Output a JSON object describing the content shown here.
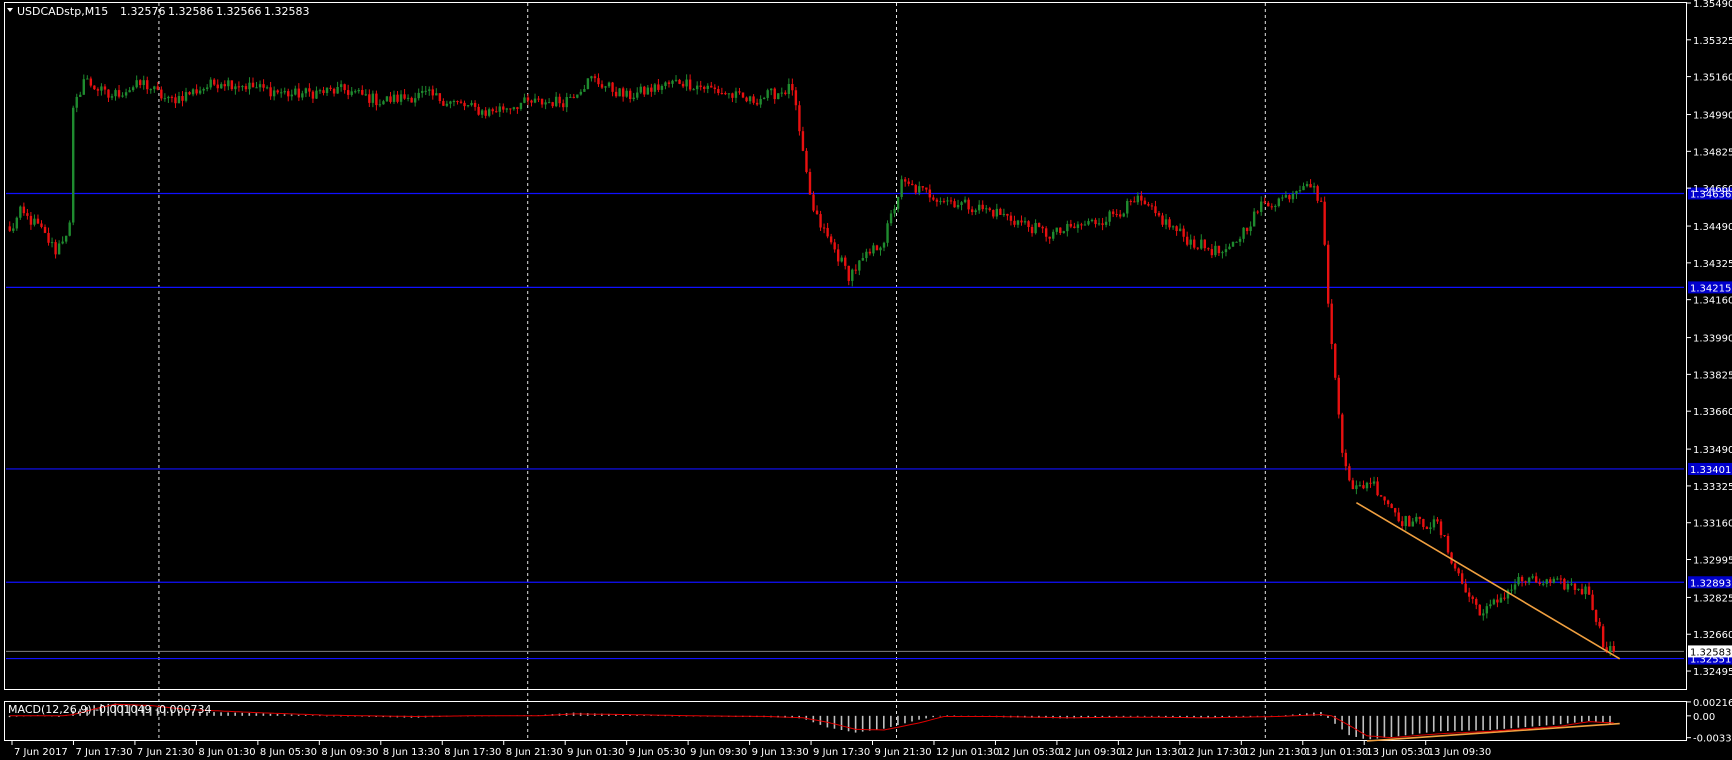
{
  "symbol": "USDCADstp,M15",
  "ohlc": {
    "open": "1.32576",
    "high": "1.32586",
    "low": "1.32566",
    "close": "1.32583"
  },
  "header_menu_icon": "triangle-down-icon",
  "colors": {
    "background": "#000000",
    "bull_candle": "#1f8b2f",
    "bear_candle": "#e81010",
    "level_line": "#1010ff",
    "level_tag": "#0000cc",
    "trendline": "#f0a040",
    "macd_hist": "#c0c0c0",
    "macd_signal": "#e00000",
    "current_price_line": "#808080"
  },
  "chart_data": {
    "type": "candlestick",
    "price_axis": {
      "ylim": [
        1.3241,
        1.3549
      ],
      "ticks": [
        "1.35490",
        "1.35325",
        "1.35160",
        "1.34990",
        "1.34825",
        "1.34660",
        "1.34490",
        "1.34325",
        "1.34160",
        "1.33990",
        "1.33825",
        "1.33660",
        "1.33490",
        "1.33325",
        "1.33160",
        "1.32995",
        "1.32825",
        "1.32660",
        "1.32495"
      ],
      "current_price": "1.32583"
    },
    "time_axis": {
      "labels": [
        "7 Jun 2017",
        "7 Jun 17:30",
        "7 Jun 21:30",
        "8 Jun 01:30",
        "8 Jun 05:30",
        "8 Jun 09:30",
        "8 Jun 13:30",
        "8 Jun 17:30",
        "8 Jun 21:30",
        "9 Jun 01:30",
        "9 Jun 05:30",
        "9 Jun 09:30",
        "9 Jun 13:30",
        "9 Jun 17:30",
        "9 Jun 21:30",
        "12 Jun 01:30",
        "12 Jun 05:30",
        "12 Jun 09:30",
        "12 Jun 13:30",
        "12 Jun 17:30",
        "12 Jun 21:30",
        "13 Jun 01:30",
        "13 Jun 05:30",
        "13 Jun 09:30"
      ],
      "day_separators": [
        "7 Jun 21:30",
        "8 Jun 21:30",
        "9 Jun 21:30",
        "12 Jun 21:30"
      ]
    },
    "anchors": [
      {
        "bar": 0,
        "price": 1.3446
      },
      {
        "bar": 3,
        "price": 1.3455
      },
      {
        "bar": 8,
        "price": 1.3449
      },
      {
        "bar": 13,
        "price": 1.3438
      },
      {
        "bar": 17,
        "price": 1.3449
      },
      {
        "bar": 18,
        "price": 1.35
      },
      {
        "bar": 21,
        "price": 1.3515
      },
      {
        "bar": 28,
        "price": 1.3507
      },
      {
        "bar": 38,
        "price": 1.3513
      },
      {
        "bar": 45,
        "price": 1.3505
      },
      {
        "bar": 60,
        "price": 1.3514
      },
      {
        "bar": 80,
        "price": 1.3508
      },
      {
        "bar": 95,
        "price": 1.351
      },
      {
        "bar": 105,
        "price": 1.3505
      },
      {
        "bar": 118,
        "price": 1.3508
      },
      {
        "bar": 135,
        "price": 1.35
      },
      {
        "bar": 145,
        "price": 1.3504
      },
      {
        "bar": 157,
        "price": 1.3505
      },
      {
        "bar": 165,
        "price": 1.3515
      },
      {
        "bar": 175,
        "price": 1.3507
      },
      {
        "bar": 190,
        "price": 1.3514
      },
      {
        "bar": 200,
        "price": 1.351
      },
      {
        "bar": 210,
        "price": 1.3505
      },
      {
        "bar": 222,
        "price": 1.3511
      },
      {
        "bar": 225,
        "price": 1.348
      },
      {
        "bar": 228,
        "price": 1.3455
      },
      {
        "bar": 238,
        "price": 1.3427
      },
      {
        "bar": 248,
        "price": 1.3443
      },
      {
        "bar": 253,
        "price": 1.3468
      },
      {
        "bar": 265,
        "price": 1.3461
      },
      {
        "bar": 280,
        "price": 1.3455
      },
      {
        "bar": 295,
        "price": 1.3445
      },
      {
        "bar": 310,
        "price": 1.3452
      },
      {
        "bar": 320,
        "price": 1.346
      },
      {
        "bar": 335,
        "price": 1.3442
      },
      {
        "bar": 345,
        "price": 1.3436
      },
      {
        "bar": 355,
        "price": 1.3458
      },
      {
        "bar": 362,
        "price": 1.3462
      },
      {
        "bar": 368,
        "price": 1.347
      },
      {
        "bar": 372,
        "price": 1.346
      },
      {
        "bar": 375,
        "price": 1.3395
      },
      {
        "bar": 378,
        "price": 1.335
      },
      {
        "bar": 381,
        "price": 1.333
      },
      {
        "bar": 386,
        "price": 1.3335
      },
      {
        "bar": 395,
        "price": 1.3317
      },
      {
        "bar": 405,
        "price": 1.3315
      },
      {
        "bar": 413,
        "price": 1.3285
      },
      {
        "bar": 418,
        "price": 1.3275
      },
      {
        "bar": 428,
        "price": 1.329
      },
      {
        "bar": 442,
        "price": 1.3288
      },
      {
        "bar": 448,
        "price": 1.3285
      },
      {
        "bar": 452,
        "price": 1.3262
      },
      {
        "bar": 455,
        "price": 1.3258
      }
    ],
    "total_bars": 456,
    "horizontal_levels": [
      {
        "price": 1.34636,
        "label": "1.34636"
      },
      {
        "price": 1.34215,
        "label": "1.34215"
      },
      {
        "price": 1.33401,
        "label": "1.33401"
      },
      {
        "price": 1.32893,
        "label": "1.32893"
      },
      {
        "price": 1.32551,
        "label": "1.32551"
      }
    ],
    "trendlines": [
      {
        "pane": "price",
        "from": {
          "bar": 382,
          "price": 1.3325
        },
        "to": {
          "bar": 455,
          "price": 1.3255
        }
      },
      {
        "pane": "macd",
        "from": {
          "bar": 385,
          "value": -0.00391
        },
        "to": {
          "bar": 455,
          "value": -0.0012
        }
      }
    ],
    "macd": {
      "label": "MACD(12,26,9) -0.001049 -0.000734",
      "ylim": [
        -0.00391,
        0.00215
      ],
      "ticks": [
        "0.002165",
        "0.00",
        "-0.003391"
      ],
      "profile": [
        {
          "bar": 0,
          "hist": -0.0002,
          "signal": 0.0
        },
        {
          "bar": 8,
          "hist": 0.0001,
          "signal": 0.0
        },
        {
          "bar": 15,
          "hist": -0.0002,
          "signal": 0.0
        },
        {
          "bar": 18,
          "hist": 0.0008,
          "signal": 0.0002
        },
        {
          "bar": 25,
          "hist": 0.0018,
          "signal": 0.0012
        },
        {
          "bar": 30,
          "hist": 0.0019,
          "signal": 0.0018
        },
        {
          "bar": 40,
          "hist": 0.0014,
          "signal": 0.0016
        },
        {
          "bar": 50,
          "hist": 0.0007,
          "signal": 0.001
        },
        {
          "bar": 70,
          "hist": 0.0004,
          "signal": 0.0005
        },
        {
          "bar": 90,
          "hist": 0.0,
          "signal": 0.0001
        },
        {
          "bar": 115,
          "hist": -0.0003,
          "signal": -0.0001
        },
        {
          "bar": 130,
          "hist": 0.0,
          "signal": 0.0
        },
        {
          "bar": 150,
          "hist": 0.0001,
          "signal": 0.0
        },
        {
          "bar": 160,
          "hist": 0.0005,
          "signal": 0.0003
        },
        {
          "bar": 175,
          "hist": 0.0002,
          "signal": 0.0002
        },
        {
          "bar": 195,
          "hist": -0.0001,
          "signal": 0.0
        },
        {
          "bar": 215,
          "hist": -0.0002,
          "signal": -0.0001
        },
        {
          "bar": 225,
          "hist": -0.0004,
          "signal": -0.0003
        },
        {
          "bar": 232,
          "hist": -0.0018,
          "signal": -0.001
        },
        {
          "bar": 240,
          "hist": -0.0026,
          "signal": -0.0021
        },
        {
          "bar": 248,
          "hist": -0.002,
          "signal": -0.0022
        },
        {
          "bar": 258,
          "hist": -0.0006,
          "signal": -0.0011
        },
        {
          "bar": 265,
          "hist": 0.0001,
          "signal": -0.0001
        },
        {
          "bar": 280,
          "hist": -0.0002,
          "signal": -0.0001
        },
        {
          "bar": 300,
          "hist": -0.0004,
          "signal": -0.0003
        },
        {
          "bar": 320,
          "hist": -0.0001,
          "signal": -0.0002
        },
        {
          "bar": 340,
          "hist": -0.0003,
          "signal": -0.0003
        },
        {
          "bar": 360,
          "hist": 0.0,
          "signal": -0.0001
        },
        {
          "bar": 372,
          "hist": 0.0006,
          "signal": 0.0002
        },
        {
          "bar": 375,
          "hist": -0.0008,
          "signal": 0.0
        },
        {
          "bar": 380,
          "hist": -0.003,
          "signal": -0.0015
        },
        {
          "bar": 385,
          "hist": -0.0037,
          "signal": -0.0031
        },
        {
          "bar": 392,
          "hist": -0.0033,
          "signal": -0.0034
        },
        {
          "bar": 405,
          "hist": -0.0024,
          "signal": -0.0028
        },
        {
          "bar": 420,
          "hist": -0.0022,
          "signal": -0.0024
        },
        {
          "bar": 440,
          "hist": -0.0013,
          "signal": -0.0016
        },
        {
          "bar": 448,
          "hist": -0.0008,
          "signal": -0.0009
        },
        {
          "bar": 455,
          "hist": -0.0013,
          "signal": -0.0011
        }
      ]
    }
  }
}
